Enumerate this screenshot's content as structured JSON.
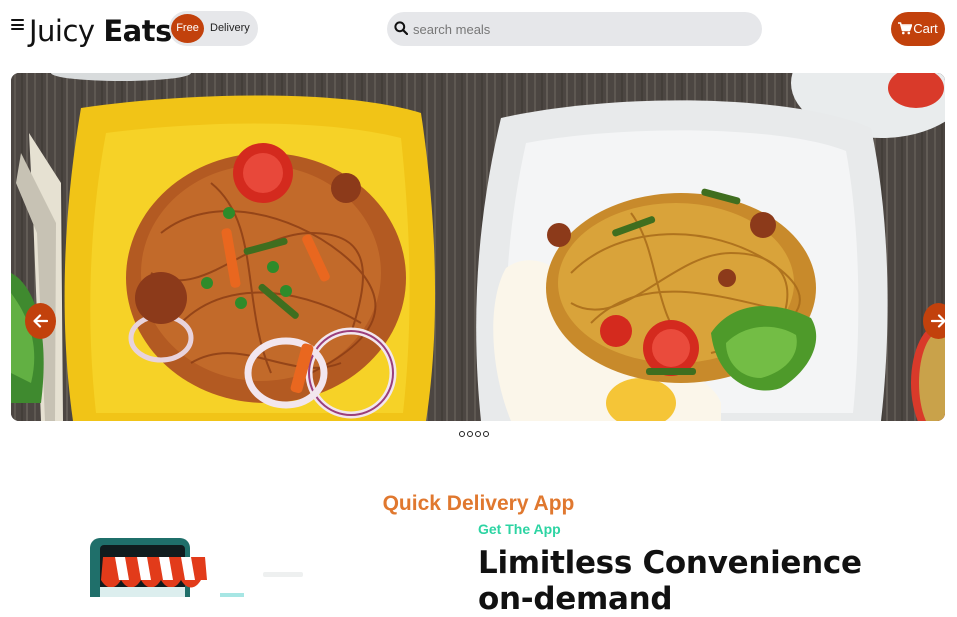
{
  "header": {
    "brand_light": "Juicy",
    "brand_bold": "Eats",
    "toggle": {
      "active": "Free",
      "inactive": "Delivery"
    },
    "search": {
      "placeholder": "search meals",
      "value": ""
    },
    "cart_label": "Cart"
  },
  "carousel": {
    "slide_count": 4,
    "active_slide": 1,
    "image_description_icon": "food-photo"
  },
  "section": {
    "title": "Quick Delivery App",
    "eyebrow": "Get The App",
    "headline": "Limitless Convenience on-demand"
  },
  "colors": {
    "accent": "#c2410c",
    "title_orange": "#e0782f",
    "eyebrow_green": "#2dd4a3",
    "pill_gray": "#e6e7ea"
  }
}
